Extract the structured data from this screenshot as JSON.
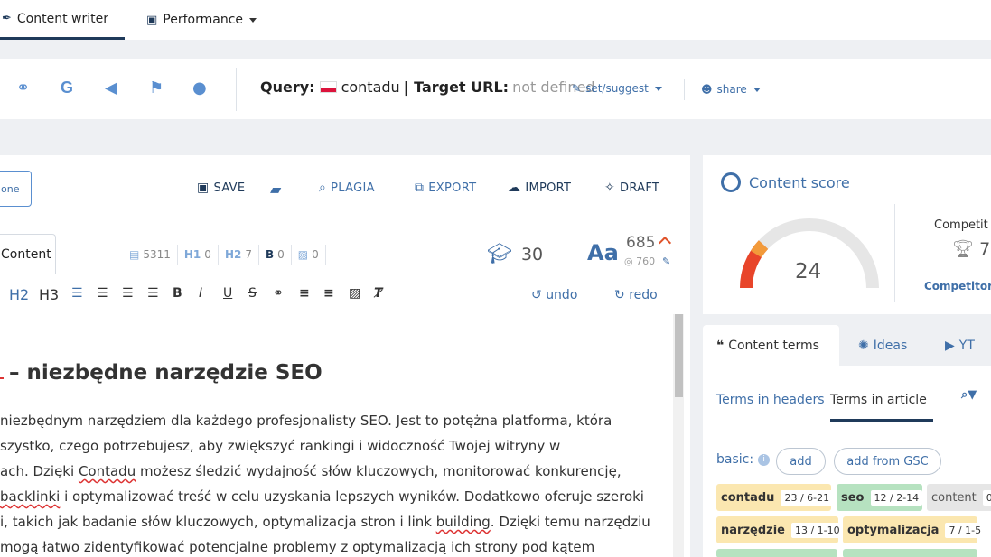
{
  "topnav": {
    "content_writer": "Content writer",
    "performance": "Performance"
  },
  "querybar": {
    "query_label": "Query:",
    "query_value": "contadu",
    "target_label": "| Target URL:",
    "target_value": "not defined",
    "set_suggest": "set/suggest",
    "share": "share"
  },
  "editor": {
    "one_button": "one",
    "actions": {
      "save": "SAVE",
      "plagia": "PLAGIA",
      "export": "EXPORT",
      "import": "IMPORT",
      "draft": "DRAFT"
    },
    "content_tab": "Content",
    "stats": {
      "chars": "5311",
      "h1": "0",
      "h2": "7",
      "bold": "0",
      "images": "0"
    },
    "readability": "30",
    "words": "685",
    "words_target": "760",
    "toolbar": {
      "h2": "H2",
      "h3": "H3",
      "undo": "undo",
      "redo": "redo"
    },
    "heading": "– niezbędne narzędzie SEO",
    "lines": [
      " niezbędnym narzędziem dla każdego profesjonalisty SEO. Jest to potężna platforma, która",
      "szystko, czego potrzebujesz, aby zwiększyć rankingi i widoczność Twojej witryny w",
      "ach. Dzięki ",
      "Contadu",
      " możesz śledzić wydajność słów kluczowych, monitorować konkurencję,",
      "backlinki",
      " i optymalizować treść w celu uzyskania lepszych wyników. Dodatkowo oferuje szeroki",
      "i, takich jak badanie słów kluczowych, optymalizacja stron i link ",
      "building",
      ". Dzięki temu narzędziu",
      " mogą łatwo zidentyfikować potencjalne problemy z optymalizacją ich strony pod kątem"
    ]
  },
  "score": {
    "title": "Content score",
    "value": "24",
    "value_fraction": 0.24,
    "competitors_label": "Competit",
    "competitors_value": "7",
    "competitors_link": "Competitors"
  },
  "terms": {
    "tabs": [
      "Content terms",
      "Ideas",
      "YT"
    ],
    "subtabs": [
      "Terms in headers",
      "Terms in article"
    ],
    "basic_label": "basic:",
    "add": "add",
    "add_gsc": "add from GSC",
    "items": [
      {
        "name": "contadu",
        "count": "23 / 6-21"
      },
      {
        "name": "seo",
        "count": "12 / 2-14"
      },
      {
        "name": "content",
        "count": "0"
      },
      {
        "name": "narzędzie",
        "count": "13 / 1-10"
      },
      {
        "name": "optymalizacja",
        "count": "7 / 1-5"
      }
    ]
  },
  "colors": {
    "accent": "#3f6fa8",
    "dark": "#1f3a5a",
    "gauge_red": "#e8452a",
    "gauge_orange": "#f29a3a",
    "term_yellow": "#fbe7b0",
    "term_green": "#b6e2c0"
  }
}
